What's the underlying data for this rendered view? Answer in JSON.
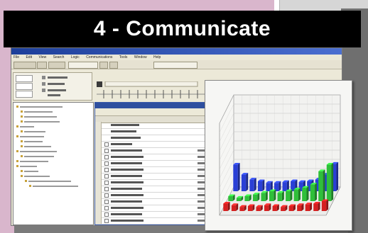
{
  "banner": {
    "title": "4 - Communicate"
  },
  "app": {
    "menu": [
      "File",
      "Edit",
      "View",
      "Search",
      "Logic",
      "Communications",
      "Tools",
      "Window",
      "Help"
    ]
  },
  "chart_data": {
    "type": "bar",
    "title": "",
    "xlabel": "",
    "ylabel": "",
    "ylim": [
      0,
      100
    ],
    "grid": true,
    "colors": {
      "blue": "#2a3fd6",
      "green": "#2fbf3a",
      "red": "#d62020"
    },
    "series": [
      {
        "values": [
          32,
          20,
          14,
          12,
          10,
          10,
          11,
          12,
          11,
          12,
          14,
          20,
          33
        ]
      },
      {
        "values": [
          6,
          4,
          6,
          8,
          10,
          12,
          10,
          12,
          14,
          16,
          20,
          36,
          44
        ]
      },
      {
        "values": [
          9,
          7,
          5,
          6,
          5,
          7,
          6,
          5,
          6,
          7,
          8,
          9,
          12
        ]
      }
    ]
  }
}
